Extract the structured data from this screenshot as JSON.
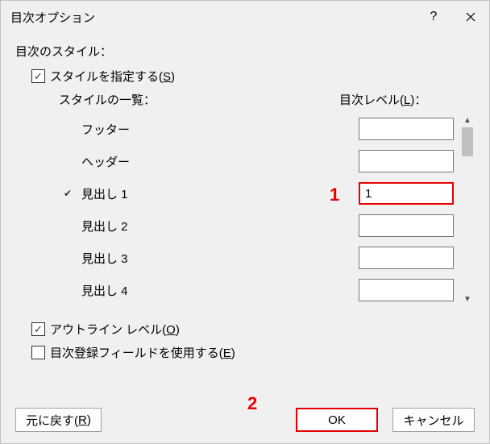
{
  "title": "目次オプション",
  "labels": {
    "section": "目次のスタイル：",
    "styleListHeader": "スタイルの一覧：",
    "levelHeaderPrefix": "目次レベル(",
    "levelHeaderKey": "L",
    "levelHeaderSuffix": ")："
  },
  "checkboxes": {
    "useStyles": {
      "prefix": "スタイルを指定する(",
      "key": "S",
      "suffix": ")",
      "checked": true
    },
    "outline": {
      "prefix": "アウトライン レベル(",
      "key": "O",
      "suffix": ")",
      "checked": true
    },
    "tocFields": {
      "prefix": "目次登録フィールドを使用する(",
      "key": "E",
      "suffix": ")",
      "checked": false
    }
  },
  "styles": [
    {
      "name": "フッター",
      "level": "",
      "marked": false,
      "highlight": false
    },
    {
      "name": "ヘッダー",
      "level": "",
      "marked": false,
      "highlight": false
    },
    {
      "name": "見出し 1",
      "level": "1",
      "marked": true,
      "highlight": true
    },
    {
      "name": "見出し 2",
      "level": "",
      "marked": false,
      "highlight": false
    },
    {
      "name": "見出し 3",
      "level": "",
      "marked": false,
      "highlight": false
    },
    {
      "name": "見出し 4",
      "level": "",
      "marked": false,
      "highlight": false
    }
  ],
  "buttons": {
    "reset": {
      "prefix": "元に戻す(",
      "key": "R",
      "suffix": ")"
    },
    "ok": {
      "label": "OK",
      "highlight": true
    },
    "cancel": {
      "label": "キャンセル"
    }
  },
  "annotations": {
    "one": "1",
    "two": "2"
  }
}
